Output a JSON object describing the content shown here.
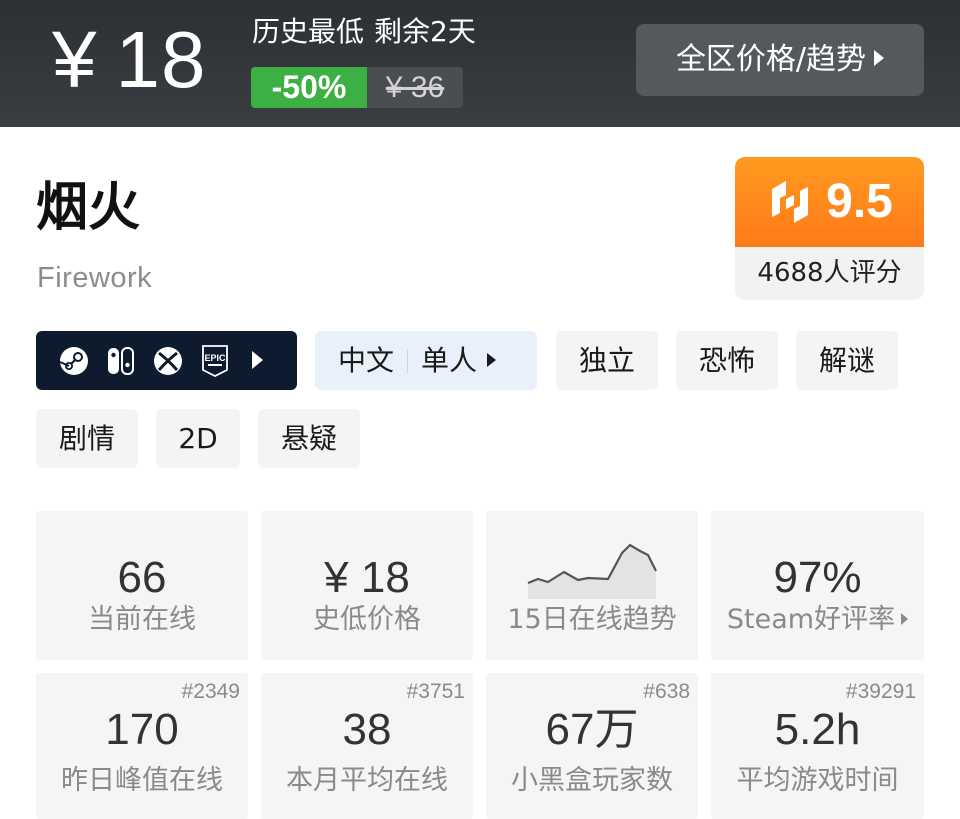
{
  "price": {
    "currency": "¥",
    "current": "18",
    "label_lowest": "历史最低",
    "label_remaining": "剩余2天",
    "discount": "-50%",
    "original": "¥ 36",
    "region_button": "全区价格/趋势"
  },
  "game": {
    "title": "烟火",
    "subtitle": "Firework"
  },
  "score": {
    "value": "9.5",
    "count": "4688人评分",
    "logo_icon": "heybox-logo-icon"
  },
  "platforms": {
    "icons": [
      "steam-icon",
      "switch-icon",
      "xbox-icon",
      "epic-icon"
    ],
    "epic_text": "EPIC"
  },
  "tags": {
    "language": "中文",
    "mode": "单人",
    "items": [
      "独立",
      "恐怖",
      "解谜",
      "剧情",
      "2D",
      "悬疑"
    ]
  },
  "stats": [
    {
      "value": "66",
      "label": "当前在线",
      "rank": ""
    },
    {
      "value": "¥ 18",
      "label": "史低价格",
      "rank": ""
    },
    {
      "value": "",
      "label": "15日在线趋势",
      "rank": ""
    },
    {
      "value": "97%",
      "label": "Steam好评率",
      "rank": ""
    },
    {
      "value": "170",
      "label": "昨日峰值在线",
      "rank": "#2349"
    },
    {
      "value": "38",
      "label": "本月平均在线",
      "rank": "#3751"
    },
    {
      "value": "67万",
      "label": "小黑盒玩家数",
      "rank": "#638"
    },
    {
      "value": "5.2h",
      "label": "平均游戏时间",
      "rank": "#39291"
    }
  ],
  "colors": {
    "header_bg": "#33363a",
    "discount_green": "#3cb043",
    "score_orange": "#ff8a1c",
    "platform_bg": "#0e1b2e",
    "lang_tag_bg": "#e8f1fb",
    "tag_bg": "#f3f4f6",
    "stat_bg": "#f5f5f5"
  }
}
